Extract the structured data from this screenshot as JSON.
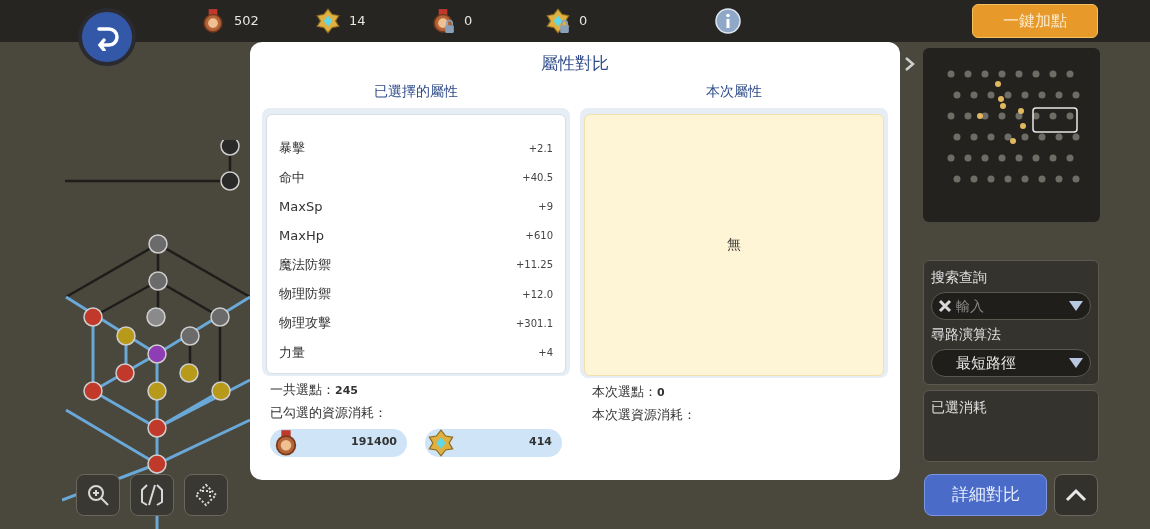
{
  "top_bar": {
    "resources": [
      {
        "kind": "medal",
        "count": "502"
      },
      {
        "kind": "crystal",
        "count": "14"
      },
      {
        "kind": "medal_locked",
        "count": "0"
      },
      {
        "kind": "crystal_locked",
        "count": "0"
      }
    ],
    "auto_add_button": "一鍵加點"
  },
  "dialog": {
    "title": "屬性對比",
    "selected_column": {
      "heading": "已選擇的屬性",
      "attributes": [
        {
          "name": "暴擊",
          "value": "+2.1"
        },
        {
          "name": "命中",
          "value": "+40.5"
        },
        {
          "name": "MaxSp",
          "value": "+9"
        },
        {
          "name": "MaxHp",
          "value": "+610"
        },
        {
          "name": "魔法防禦",
          "value": "+11.25"
        },
        {
          "name": "物理防禦",
          "value": "+12.0"
        },
        {
          "name": "物理攻擊",
          "value": "+301.1"
        },
        {
          "name": "力量",
          "value": "+4"
        }
      ],
      "total_points_label": "一共選點：",
      "total_points": "245",
      "cost_label": "已勾選的資源消耗：",
      "costs": [
        {
          "kind": "medal",
          "amount": "191400"
        },
        {
          "kind": "crystal",
          "amount": "414"
        }
      ]
    },
    "current_column": {
      "heading": "本次屬性",
      "empty_text": "無",
      "points_label": "本次選點：",
      "points": "0",
      "cost_label": "本次選資源消耗："
    }
  },
  "side_panel": {
    "search_label": "搜索查詢",
    "search_field": {
      "placeholder": "輸入"
    },
    "algorithm_label": "尋路演算法",
    "algorithm_value": "最短路徑",
    "cost_title": "已選消耗"
  },
  "detail_compare_button": "詳細對比"
}
